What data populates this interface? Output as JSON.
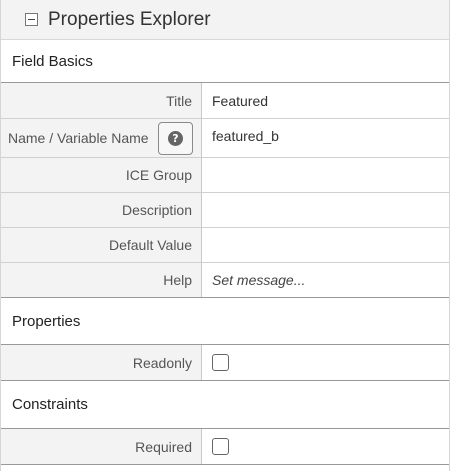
{
  "header": {
    "title": "Properties Explorer"
  },
  "sections": {
    "field_basics": "Field Basics",
    "properties": "Properties",
    "constraints": "Constraints"
  },
  "fields": {
    "title": {
      "label": "Title",
      "value": "Featured"
    },
    "name": {
      "label": "Name / Variable Name",
      "value": "featured_b"
    },
    "ice_group": {
      "label": "ICE Group",
      "value": ""
    },
    "description": {
      "label": "Description",
      "value": ""
    },
    "default_value": {
      "label": "Default Value",
      "value": ""
    },
    "help": {
      "label": "Help",
      "value": "Set message..."
    },
    "readonly": {
      "label": "Readonly",
      "checked": false
    },
    "required": {
      "label": "Required",
      "checked": false
    }
  },
  "icons": {
    "collapse": "minus-box-icon",
    "help": "question-circle-icon"
  }
}
